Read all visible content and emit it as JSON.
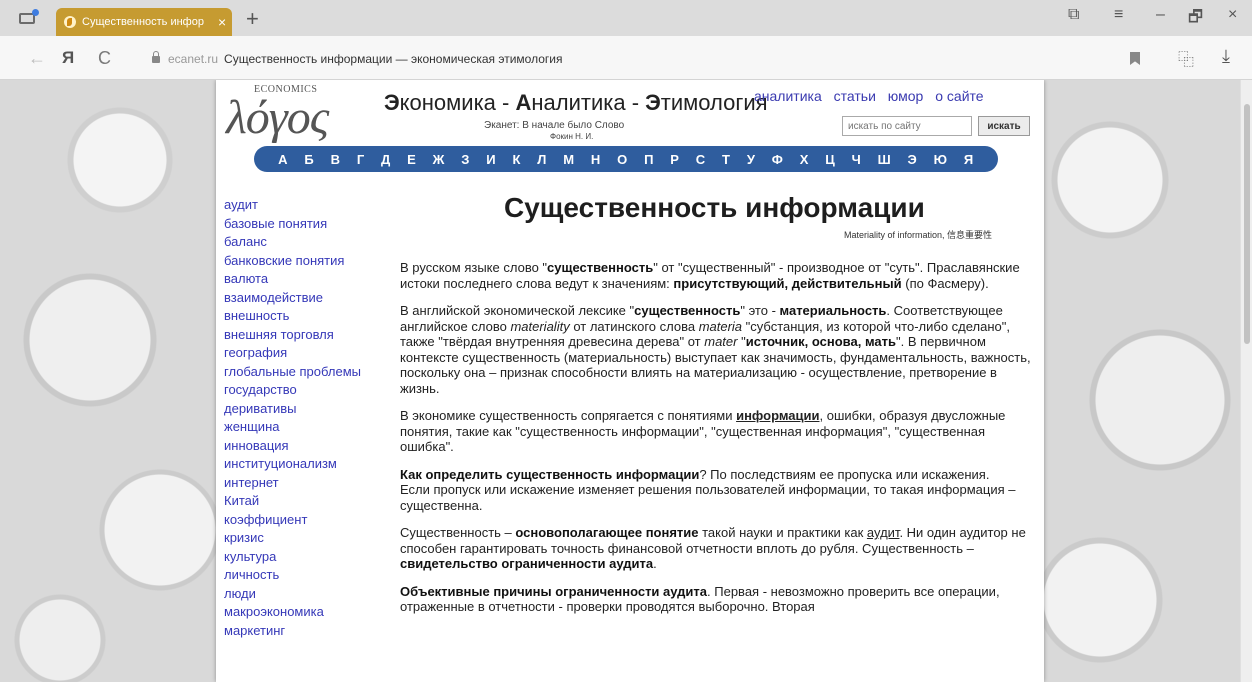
{
  "tab": {
    "title": "Существенность инфор",
    "close": "×",
    "new_tab": "+"
  },
  "window": {
    "tabs_icon": "⧉",
    "menu_icon": "≡",
    "minimize": "–",
    "restore": "🗗",
    "close": "×"
  },
  "address": {
    "back": "←",
    "yandex": "Я",
    "reload": "C",
    "host": "ecanet.ru",
    "page_title": "Существенность информации — экономическая этимология",
    "translate": "⿻",
    "download": "⤓"
  },
  "header": {
    "logo_top": "ECONOMICS",
    "logo_main": "λόγος",
    "title_part1": "Э",
    "title_part2": "кономика - ",
    "title_part3": "А",
    "title_part4": "налитика - ",
    "title_part5": "Э",
    "title_part6": "тимология",
    "slogan": "Эканет: В начале было Слово",
    "author": "Фокин Н. И.",
    "nav": [
      "аналитика",
      "статьи",
      "юмор",
      "о сайте"
    ],
    "search_placeholder": "искать по сайту",
    "search_button": "искать"
  },
  "alphabet": [
    "А",
    "Б",
    "В",
    "Г",
    "Д",
    "Е",
    "Ж",
    "З",
    "И",
    "К",
    "Л",
    "М",
    "Н",
    "О",
    "П",
    "Р",
    "С",
    "Т",
    "У",
    "Ф",
    "Х",
    "Ц",
    "Ч",
    "Ш",
    "Э",
    "Ю",
    "Я"
  ],
  "sidebar": [
    "аудит",
    "базовые понятия",
    "баланс",
    "банковские понятия",
    "валюта",
    "взаимодействие",
    "внешность",
    "внешняя торговля",
    "география",
    "глобальные проблемы",
    "государство",
    "деривативы",
    "женщина",
    "инновация",
    "институционализм",
    "интернет",
    "Китай",
    "коэффициент",
    "кризис",
    "культура",
    "личность",
    "люди",
    "макроэкономика",
    "маркетинг"
  ],
  "article": {
    "title": "Существенность информации",
    "subtitle": "Materiality of information, 信息重要性",
    "p1": [
      "В русском языке слово \"",
      "существенность",
      "\" от \"существенный\" - производное от \"суть\". Праславянские истоки последнего слова ведут к значениям: ",
      "присутствующий, действительный",
      " (по Фасмеру)."
    ],
    "p2": [
      "В английской экономической лексике \"",
      "существенность",
      "\" это - ",
      "материальность",
      ". Соответствующее английское слово ",
      "materiality",
      " от латинского слова ",
      "materia",
      " \"субстанция, из которой что-либо сделано\", также \"твёрдая внутренняя древесина дерева\" от ",
      "mater",
      " \"",
      "источник, основа, мать",
      "\". В первичном контексте существенность (материальность) выступает как значимость, фундаментальность, важность, поскольку она – признак способности влиять на материализацию - осуществление, претворение в жизнь."
    ],
    "p3": [
      "В экономике существенность сопрягается с понятиями ",
      "информации",
      ", ошибки, образуя двусложные понятия, такие как \"существенность информации\", \"существенная информация\", \"существенная ошибка\"."
    ],
    "p4": [
      "Как определить существенность информации",
      "? По последствиям ее пропуска или искажения.",
      "Если пропуск или искажение изменяет решения пользователей информации, то такая информация – существенна."
    ],
    "p5": [
      "Существенность – ",
      "основополагающее понятие",
      " такой науки и практики как ",
      "аудит",
      ". Ни один аудитор не способен гарантировать точность финансовой отчетности вплоть до рубля. Существенность – ",
      "свидетельство ограниченности аудита",
      "."
    ],
    "p6": [
      "Объективные причины ограниченности аудита",
      ". Первая - невозможно проверить все операции, отраженные в отчетности - проверки проводятся выборочно. Вторая"
    ]
  }
}
